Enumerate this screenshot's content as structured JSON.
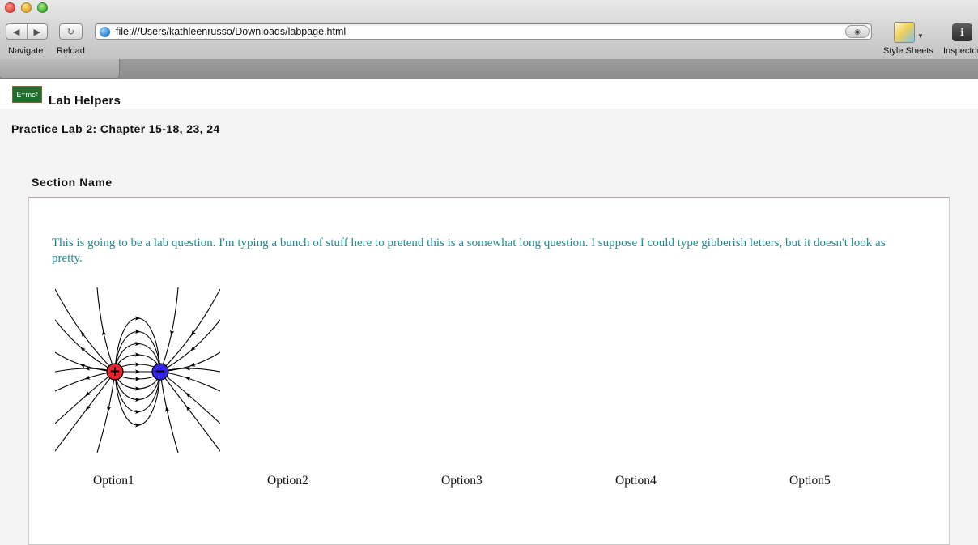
{
  "browser": {
    "nav_label": "Navigate",
    "reload_label": "Reload",
    "url": "file:///Users/kathleenrusso/Downloads/labpage.html",
    "style_sheets_label": "Style Sheets",
    "inspector_label": "Inspector",
    "icons": [
      "back-arrow-icon",
      "forward-arrow-icon",
      "reload-icon",
      "globe-icon",
      "reader-icon",
      "style-sheets-icon",
      "inspector-icon"
    ]
  },
  "site": {
    "logo_text": "E=mc²",
    "title": "Lab Helpers"
  },
  "lab": {
    "title": "Practice Lab 2: Chapter 15-18, 23, 24",
    "section_name": "Section Name",
    "question": "This is going to be a lab question. I'm typing a bunch of stuff here to pretend this is a somewhat long question. I suppose I could type gibberish letters, but it doesn't look as pretty.",
    "figure": {
      "positive_charge": "+",
      "negative_charge": "−",
      "positive_color": "#e8222e",
      "negative_color": "#3326e8"
    },
    "options": [
      "Option1",
      "Option2",
      "Option3",
      "Option4",
      "Option5"
    ]
  }
}
